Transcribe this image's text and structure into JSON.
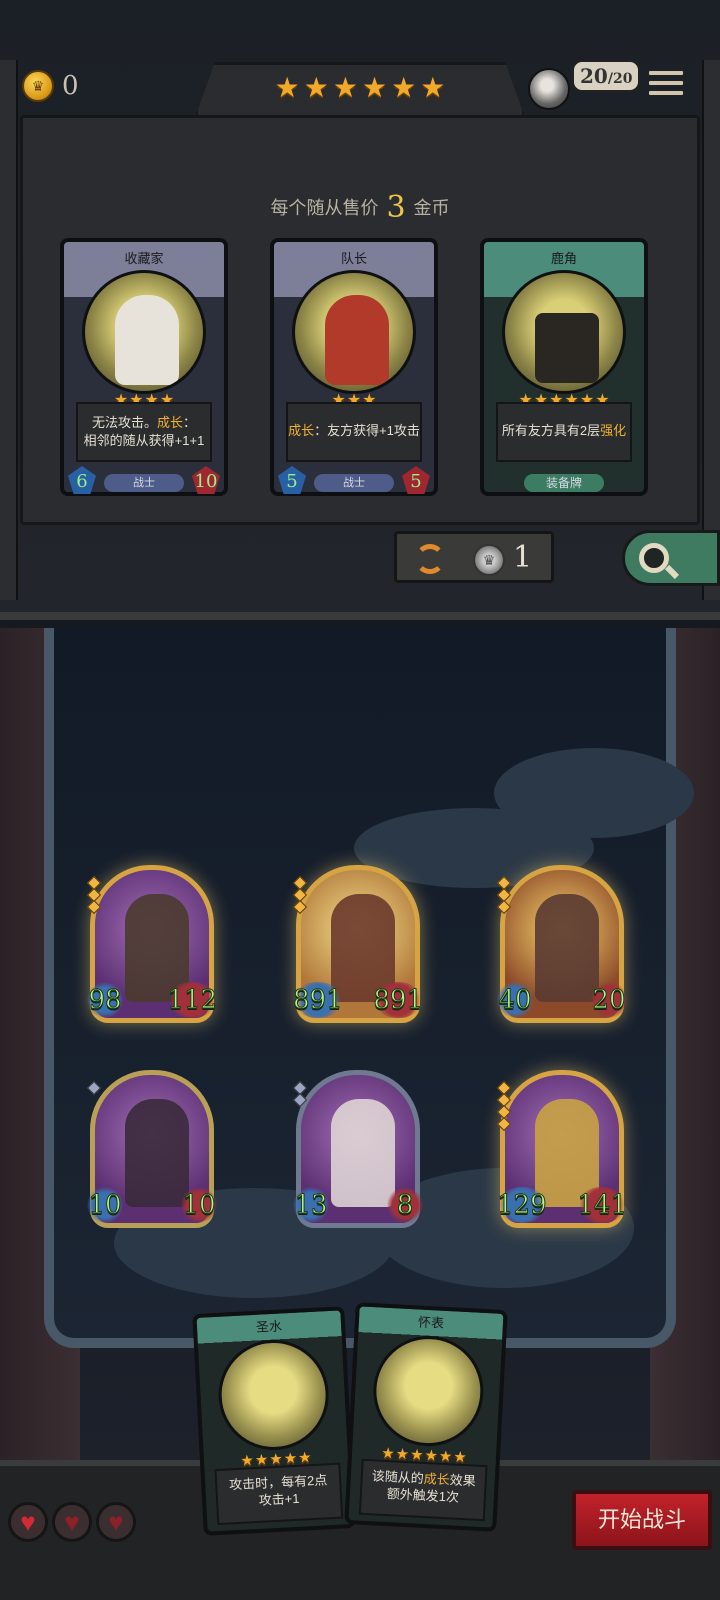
{
  "header": {
    "gold": "0",
    "tier_star_count": 6,
    "player_health": "20",
    "player_health_max": "20"
  },
  "shop": {
    "price_prefix": "每个随从售价",
    "price_value": "3",
    "price_suffix": "金币",
    "cards": [
      {
        "name": "收藏家",
        "stars": 4,
        "text_parts": [
          "无法攻击。",
          "成长",
          "：",
          "相邻的随从获得+1+1"
        ],
        "attack": "6",
        "health": "10",
        "type": "战士",
        "frame": "purple"
      },
      {
        "name": "队长",
        "stars": 3,
        "text_parts": [
          "",
          "成长",
          "：友方获得+1攻击",
          ""
        ],
        "attack": "5",
        "health": "5",
        "type": "战士",
        "frame": "purple"
      },
      {
        "name": "鹿角",
        "stars": 6,
        "text_parts": [
          "所有友方具有2层",
          "强化",
          "",
          ""
        ],
        "attack": "",
        "health": "",
        "type": "装备牌",
        "frame": "green"
      }
    ],
    "refresh_cost": "1"
  },
  "board": {
    "minions": [
      {
        "attack": "98",
        "health": "112",
        "rank": "gold",
        "ranks": 3
      },
      {
        "attack": "891",
        "health": "891",
        "rank": "gold",
        "ranks": 3
      },
      {
        "attack": "40",
        "health": "20",
        "rank": "gold",
        "ranks": 3
      },
      {
        "attack": "10",
        "health": "10",
        "rank": "silver",
        "ranks": 1
      },
      {
        "attack": "13",
        "health": "8",
        "rank": "silver",
        "ranks": 2
      },
      {
        "attack": "129",
        "health": "141",
        "rank": "gold",
        "ranks": 4
      }
    ]
  },
  "hand": [
    {
      "name": "圣水",
      "stars": 5,
      "line1": "攻击时，每有2点",
      "line2": "攻击+1"
    },
    {
      "name": "怀表",
      "stars": 6,
      "line1_a": "该随从的",
      "line1_hl": "成长",
      "line1_b": "效果",
      "line2": "额外触发1次"
    }
  ],
  "lives": {
    "total": 3,
    "remaining": 1
  },
  "actions": {
    "start_battle": "开始战斗"
  },
  "colors": {
    "gold_star": "#f0a92a",
    "highlight": "#f2b22e",
    "stat_text": "#b8f58f",
    "fight_button": "#c2222b"
  }
}
